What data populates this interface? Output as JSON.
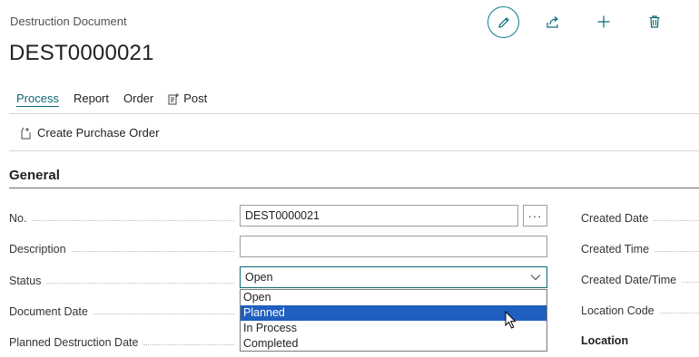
{
  "page": {
    "caption": "Destruction Document",
    "title": "DEST0000021"
  },
  "top_actions": [
    "edit-icon",
    "share-icon",
    "new-icon",
    "delete-icon"
  ],
  "menu": {
    "items": [
      {
        "label": "Process",
        "active": true
      },
      {
        "label": "Report"
      },
      {
        "label": "Order"
      },
      {
        "label": "Post",
        "icon": "post-icon"
      }
    ]
  },
  "action_bar": {
    "create_purchase_order": "Create Purchase Order"
  },
  "section": {
    "title": "General"
  },
  "fields": {
    "no": {
      "label": "No.",
      "value": "DEST0000021"
    },
    "description": {
      "label": "Description",
      "value": ""
    },
    "status": {
      "label": "Status",
      "value": "Open",
      "options": [
        "Open",
        "Planned",
        "In Process",
        "Completed"
      ],
      "highlighted": "Planned"
    },
    "document_date": {
      "label": "Document Date"
    },
    "planned_destruction_date": {
      "label": "Planned Destruction Date"
    }
  },
  "right_fields": {
    "created_date": "Created Date",
    "created_time": "Created Time",
    "created_datetime": "Created Date/Time",
    "location_code": "Location Code",
    "location_group": "Location"
  },
  "colors": {
    "accent": "#0b6a77",
    "selection": "#1f5fbf"
  }
}
